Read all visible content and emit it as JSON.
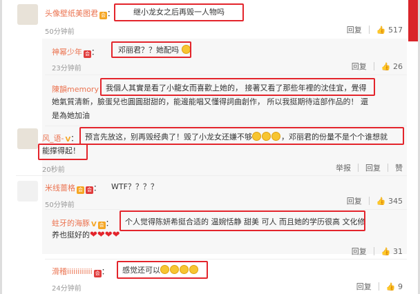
{
  "comments": [
    {
      "name": "头像壁纸美图君",
      "text": "继小龙女之后再毁一人物吗",
      "time": "50分钟前",
      "reply": "回复",
      "likes": "517"
    },
    {
      "name": "神幂少年",
      "text": "邓丽君？？她配吗",
      "time": "23分钟前",
      "reply": "回复",
      "likes": "26"
    },
    {
      "name": "陳韻memory",
      "text_line1": "我個人其實是看了小龍女而喜歡上她的， 接著又看了那些年裡的沈佳宜，覺得",
      "text_line2": "她氣質清新，臉蛋兒也圓圓甜甜的，能邊能唱又懂得詞曲創作， 所以我挺期待這部作品的！ 還",
      "text_line3": "是為她加油",
      "time": "",
      "reply": "",
      "likes": ""
    },
    {
      "name": "风_语-",
      "text_line1": "预言先放这，别再毁经典了！毁了小龙女还嫌不够",
      "text_line1b": "，邓丽君的份量不是个个谁想就",
      "text_line2": "能撑得起！",
      "time": "20秒前",
      "actions": [
        "举报",
        "回复",
        "赞"
      ]
    },
    {
      "name": "米线蔷格",
      "text": "WTF？？？？",
      "time": "50分钟前",
      "reply": "回复",
      "likes": "345"
    },
    {
      "name": "蛀牙的海豚",
      "text_line1": "个人觉得陈妍希挺合适的 温婉恬静 甜美 可人 而且她的学历很高 文化修",
      "text_line2": "养也挺好的",
      "time": "",
      "reply": "回复",
      "likes": "31"
    },
    {
      "name": "滑稽iiiiiiiiiiii",
      "text": "感觉还可以",
      "time": "24分钟前",
      "reply": "回复",
      "likes": "9"
    }
  ],
  "icons": {
    "like": "thumbs-up-icon",
    "badge": "vip-badge-icon"
  }
}
